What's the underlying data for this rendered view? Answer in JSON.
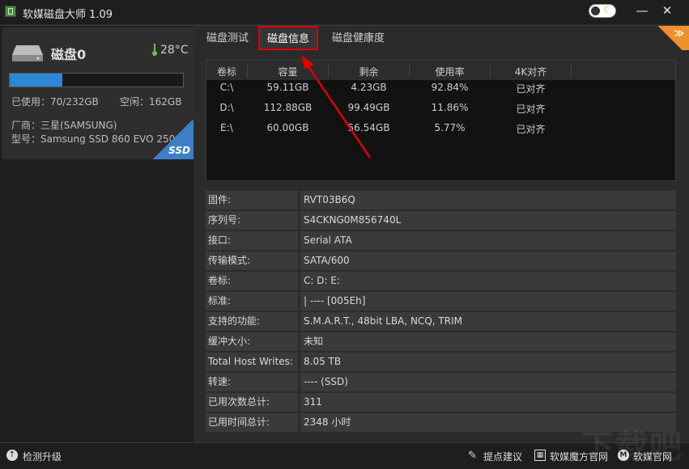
{
  "window": {
    "title": "软媒磁盘大师 1.09",
    "min_label": "—",
    "close_label": "✕"
  },
  "disk": {
    "name": "磁盘0",
    "temperature": "28°C",
    "usage_fraction": 0.3017,
    "used_text": "已使用：70/232GB",
    "free_text": "空闲：162GB",
    "vendor_text": "厂商：三星(SAMSUNG)",
    "model_text": "型号：Samsung SSD 860 EVO 250GB",
    "badge": "SSD"
  },
  "tabs": [
    {
      "label": "磁盘测试"
    },
    {
      "label": "磁盘信息"
    },
    {
      "label": "磁盘健康度"
    }
  ],
  "corner_badge": "≫",
  "volumes": {
    "headers": [
      "卷标",
      "容量",
      "剩余",
      "使用率",
      "4K对齐"
    ],
    "rows": [
      [
        "C:\\",
        "59.11GB",
        "4.23GB",
        "92.84%",
        "已对齐"
      ],
      [
        "D:\\",
        "112.88GB",
        "99.49GB",
        "11.86%",
        "已对齐"
      ],
      [
        "E:\\",
        "60.00GB",
        "56.54GB",
        "5.77%",
        "已对齐"
      ]
    ]
  },
  "info": [
    {
      "label": "固件:",
      "value": "RVT03B6Q"
    },
    {
      "label": "序列号:",
      "value": "S4CKNG0M856740L"
    },
    {
      "label": "接口:",
      "value": "Serial ATA"
    },
    {
      "label": "传输模式:",
      "value": "SATA/600"
    },
    {
      "label": "卷标:",
      "value": "C: D: E:"
    },
    {
      "label": "标准:",
      "value": "| ---- [005Eh]"
    },
    {
      "label": "支持的功能:",
      "value": "S.M.A.R.T., 48bit LBA, NCQ, TRIM"
    },
    {
      "label": "缓冲大小:",
      "value": "未知"
    },
    {
      "label": "Total Host Writes:",
      "value": "8.05 TB"
    },
    {
      "label": "转速:",
      "value": "---- (SSD)"
    },
    {
      "label": "已用次数总计:",
      "value": "311"
    },
    {
      "label": "已用时间总计:",
      "value": "2348 小时"
    }
  ],
  "statusbar": {
    "upgrade": "检测升级",
    "suggest": "提点建议",
    "site": "软媒魔方官网",
    "official": "软媒官网"
  },
  "watermark": "下载吧",
  "colors": {
    "accent_blue": "#2f86d6",
    "highlight_red": "#e00000",
    "badge_orange": "#f0922b"
  }
}
